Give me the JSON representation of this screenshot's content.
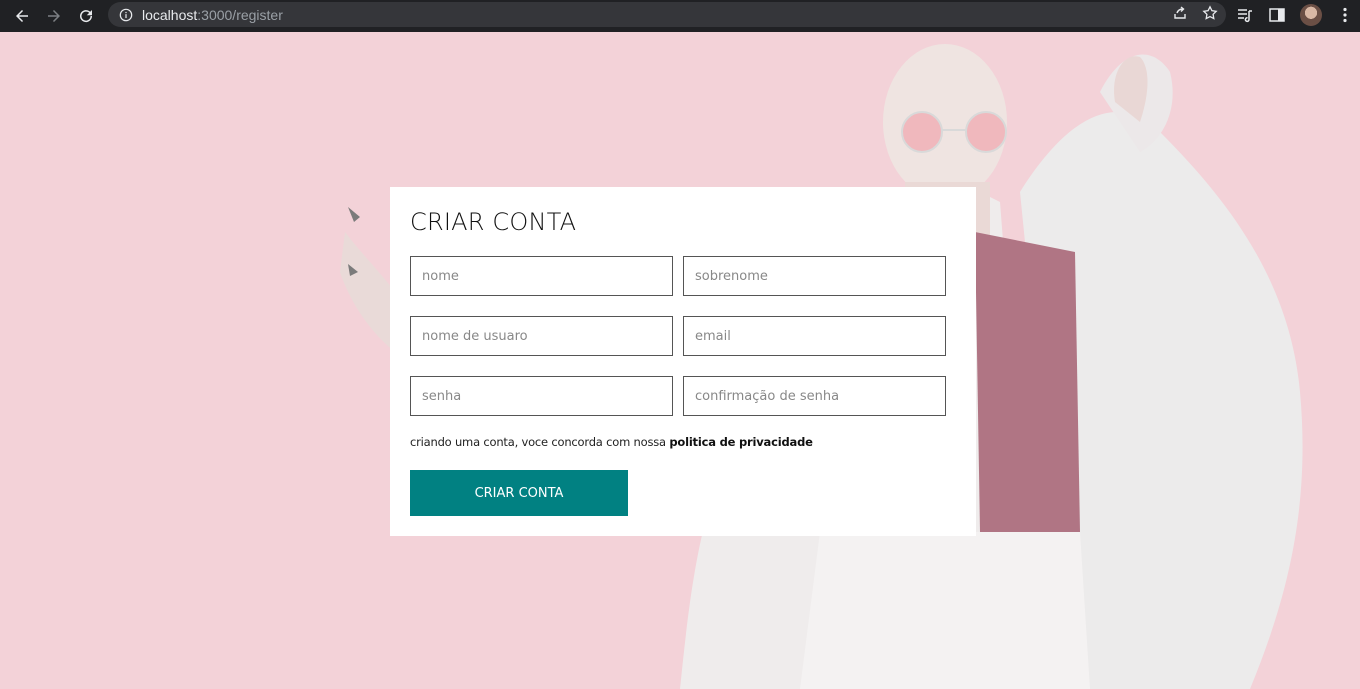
{
  "browser": {
    "url_host": "localhost",
    "url_path": ":3000/register"
  },
  "form": {
    "title": "CRIAR CONTA",
    "fields": {
      "first_name": {
        "placeholder": "nome",
        "value": ""
      },
      "last_name": {
        "placeholder": "sobrenome",
        "value": ""
      },
      "username": {
        "placeholder": "nome de usuaro",
        "value": ""
      },
      "email": {
        "placeholder": "email",
        "value": ""
      },
      "password": {
        "placeholder": "senha",
        "value": ""
      },
      "password_confirm": {
        "placeholder": "confirmação de senha",
        "value": ""
      }
    },
    "agreement_text": "criando uma conta, voce concorda com nossa ",
    "agreement_link": "politica de privacidade",
    "submit_label": "CRIAR CONTA"
  },
  "colors": {
    "background": "#f3d2d8",
    "button": "#018182",
    "chrome": "#202124"
  }
}
